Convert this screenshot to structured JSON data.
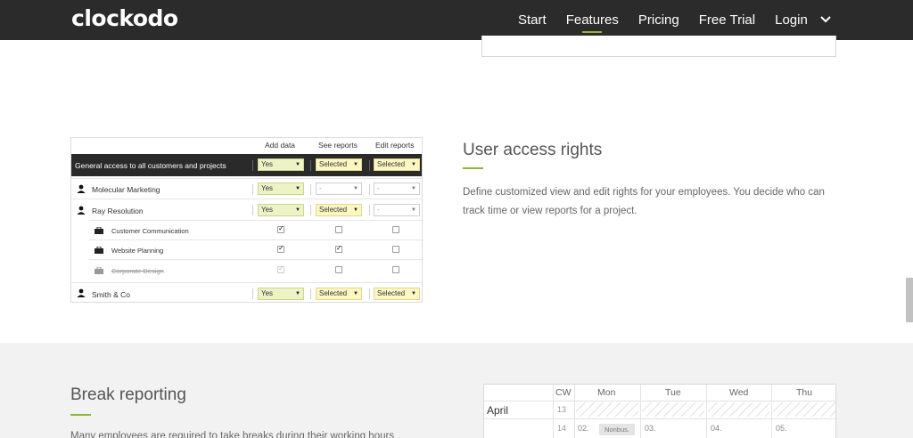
{
  "nav": {
    "logo": "clockodo",
    "items": [
      {
        "label": "Start"
      },
      {
        "label": "Features"
      },
      {
        "label": "Pricing"
      },
      {
        "label": "Free Trial"
      },
      {
        "label": "Login"
      }
    ],
    "active": "Features",
    "accent": "#8db63c",
    "icon": "chevron-down-icon"
  },
  "access_table": {
    "columns": [
      "Add data",
      "See reports",
      "Edit reports"
    ],
    "general_row": {
      "label": "General access to all customers and projects",
      "add": "Yes",
      "see": "Selected",
      "edit": "Selected"
    },
    "rows": [
      {
        "label": "Molecular Marketing",
        "add": "Yes",
        "see": "-",
        "edit": "-"
      },
      {
        "label": "Ray Resolution",
        "add": "Yes",
        "see": "Selected",
        "edit": "-"
      }
    ],
    "projects": [
      {
        "label": "Customer Communication",
        "add": true,
        "see": false,
        "edit": false
      },
      {
        "label": "Website Planning",
        "add": true,
        "see": true,
        "edit": false
      },
      {
        "label": "Corporate Design",
        "add": true,
        "see": false,
        "edit": false,
        "disabled": true
      }
    ],
    "last_row": {
      "label": "Smith & Co",
      "add": "Yes",
      "see": "Selected",
      "edit": "Selected"
    }
  },
  "feature": {
    "title": "User access rights",
    "desc": "Define customized view and edit rights for your employees. You decide who can track time or view reports for a project."
  },
  "break": {
    "title": "Break reporting",
    "text": "Many employees are required to take breaks during their working hours"
  },
  "calendar": {
    "cw_label": "CW",
    "days": [
      "Mon",
      "Tue",
      "Wed",
      "Thu"
    ],
    "month": "April",
    "cw_rows": [
      "13",
      "14"
    ],
    "dates": [
      "02.",
      "03.",
      "04.",
      "05."
    ],
    "badge": "Nonbus."
  }
}
